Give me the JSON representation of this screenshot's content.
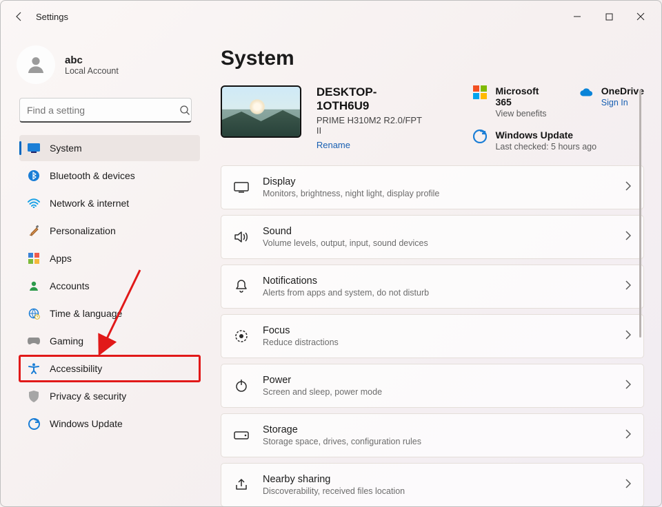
{
  "window": {
    "title": "Settings"
  },
  "user": {
    "name": "abc",
    "subtitle": "Local Account"
  },
  "search": {
    "placeholder": "Find a setting"
  },
  "sidebar": {
    "items": [
      {
        "label": "System",
        "icon": "monitor-icon",
        "active": true
      },
      {
        "label": "Bluetooth & devices",
        "icon": "bluetooth-icon"
      },
      {
        "label": "Network & internet",
        "icon": "wifi-icon"
      },
      {
        "label": "Personalization",
        "icon": "brush-icon"
      },
      {
        "label": "Apps",
        "icon": "apps-icon"
      },
      {
        "label": "Accounts",
        "icon": "person-icon"
      },
      {
        "label": "Time & language",
        "icon": "globe-clock-icon"
      },
      {
        "label": "Gaming",
        "icon": "gamepad-icon"
      },
      {
        "label": "Accessibility",
        "icon": "accessibility-icon",
        "highlight": true
      },
      {
        "label": "Privacy & security",
        "icon": "shield-icon"
      },
      {
        "label": "Windows Update",
        "icon": "update-icon"
      }
    ]
  },
  "page": {
    "title": "System"
  },
  "device": {
    "name": "DESKTOP-1OTH6U9",
    "model": "PRIME H310M2 R2.0/FPT II",
    "rename_label": "Rename"
  },
  "promos": {
    "m365": {
      "title": "Microsoft 365",
      "subtitle": "View benefits"
    },
    "onedrive": {
      "title": "OneDrive",
      "subtitle": "Sign In"
    },
    "update": {
      "title": "Windows Update",
      "subtitle": "Last checked: 5 hours ago"
    }
  },
  "settings_list": [
    {
      "icon": "display-icon",
      "title": "Display",
      "subtitle": "Monitors, brightness, night light, display profile"
    },
    {
      "icon": "sound-icon",
      "title": "Sound",
      "subtitle": "Volume levels, output, input, sound devices"
    },
    {
      "icon": "bell-icon",
      "title": "Notifications",
      "subtitle": "Alerts from apps and system, do not disturb"
    },
    {
      "icon": "focus-icon",
      "title": "Focus",
      "subtitle": "Reduce distractions"
    },
    {
      "icon": "power-icon",
      "title": "Power",
      "subtitle": "Screen and sleep, power mode"
    },
    {
      "icon": "storage-icon",
      "title": "Storage",
      "subtitle": "Storage space, drives, configuration rules"
    },
    {
      "icon": "share-icon",
      "title": "Nearby sharing",
      "subtitle": "Discoverability, received files location"
    }
  ],
  "annotation": {
    "arrow_color": "#e11919",
    "box_color": "#e11919"
  }
}
